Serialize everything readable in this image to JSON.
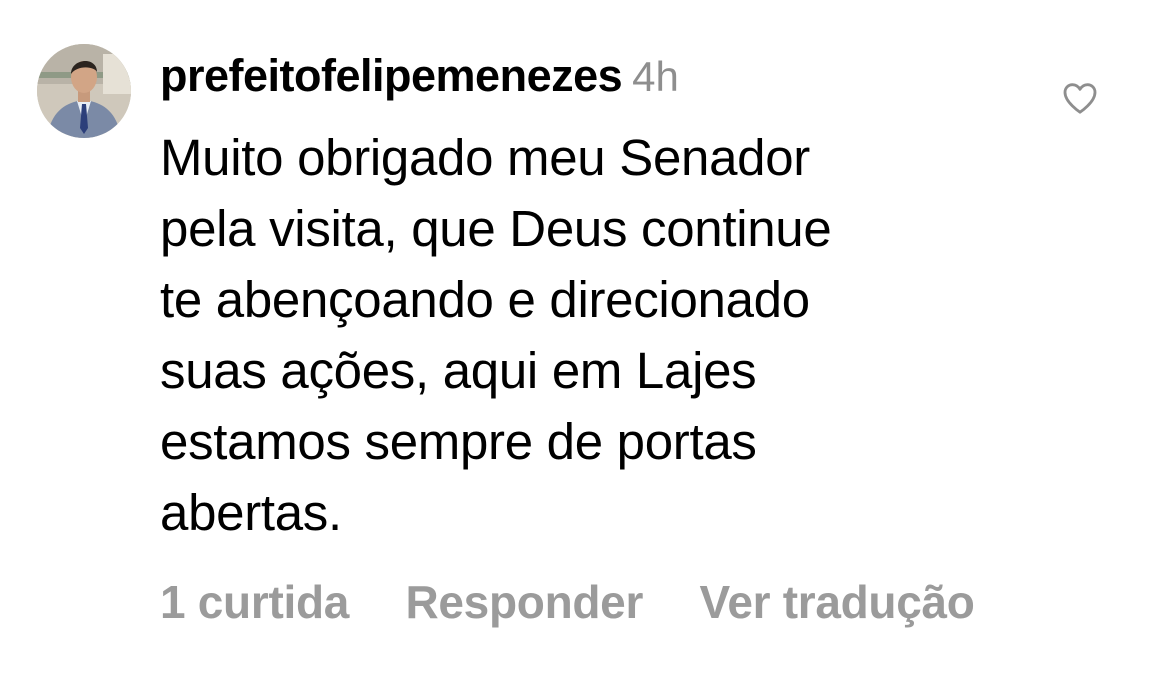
{
  "comment": {
    "avatar_icon": "profile-photo",
    "username": "prefeitofelipemenezes",
    "timestamp": "4h",
    "like_icon": "heart-outline-icon",
    "text_lines": [
      "Muito obrigado meu Senador",
      "pela visita, que Deus continue",
      "te abençoando e direcionado",
      "suas ações, aqui em Lajes",
      "estamos sempre de portas",
      "abertas."
    ],
    "actions": {
      "likes": "1 curtida",
      "reply": "Responder",
      "translate": "Ver tradução"
    },
    "colors": {
      "text": "#000000",
      "secondary": "#8e8e8e",
      "actions": "#9b9b9b"
    }
  }
}
